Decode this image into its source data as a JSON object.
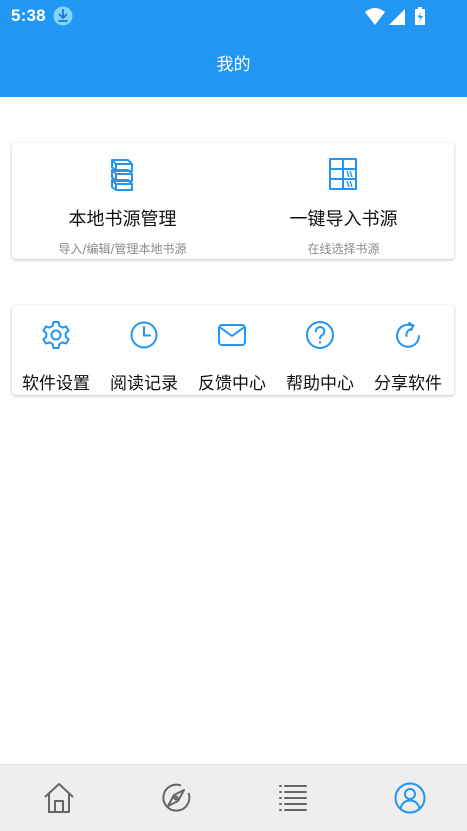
{
  "status_bar": {
    "time": "5:38",
    "icons": [
      "download-icon",
      "wifi-icon",
      "signal-icon",
      "battery-icon"
    ]
  },
  "app_bar": {
    "title": "我的"
  },
  "source_card": {
    "items": [
      {
        "icon": "books-icon",
        "title": "本地书源管理",
        "subtitle": "导入/编辑/管理本地书源"
      },
      {
        "icon": "bookshelf-icon",
        "title": "一键导入书源",
        "subtitle": "在线选择书源"
      }
    ]
  },
  "menu_card": {
    "items": [
      {
        "icon": "gear-icon",
        "label": "软件设置"
      },
      {
        "icon": "clock-icon",
        "label": "阅读记录"
      },
      {
        "icon": "mail-icon",
        "label": "反馈中心"
      },
      {
        "icon": "help-icon",
        "label": "帮助中心"
      },
      {
        "icon": "share-icon",
        "label": "分享软件"
      }
    ]
  },
  "bottom_nav": {
    "items": [
      {
        "icon": "home-icon",
        "active": false
      },
      {
        "icon": "compass-icon",
        "active": false
      },
      {
        "icon": "list-icon",
        "active": false
      },
      {
        "icon": "user-icon",
        "active": true
      }
    ]
  },
  "colors": {
    "primary": "#2196f3",
    "icon_inactive": "#666666",
    "nav_background": "#eeeeee"
  }
}
